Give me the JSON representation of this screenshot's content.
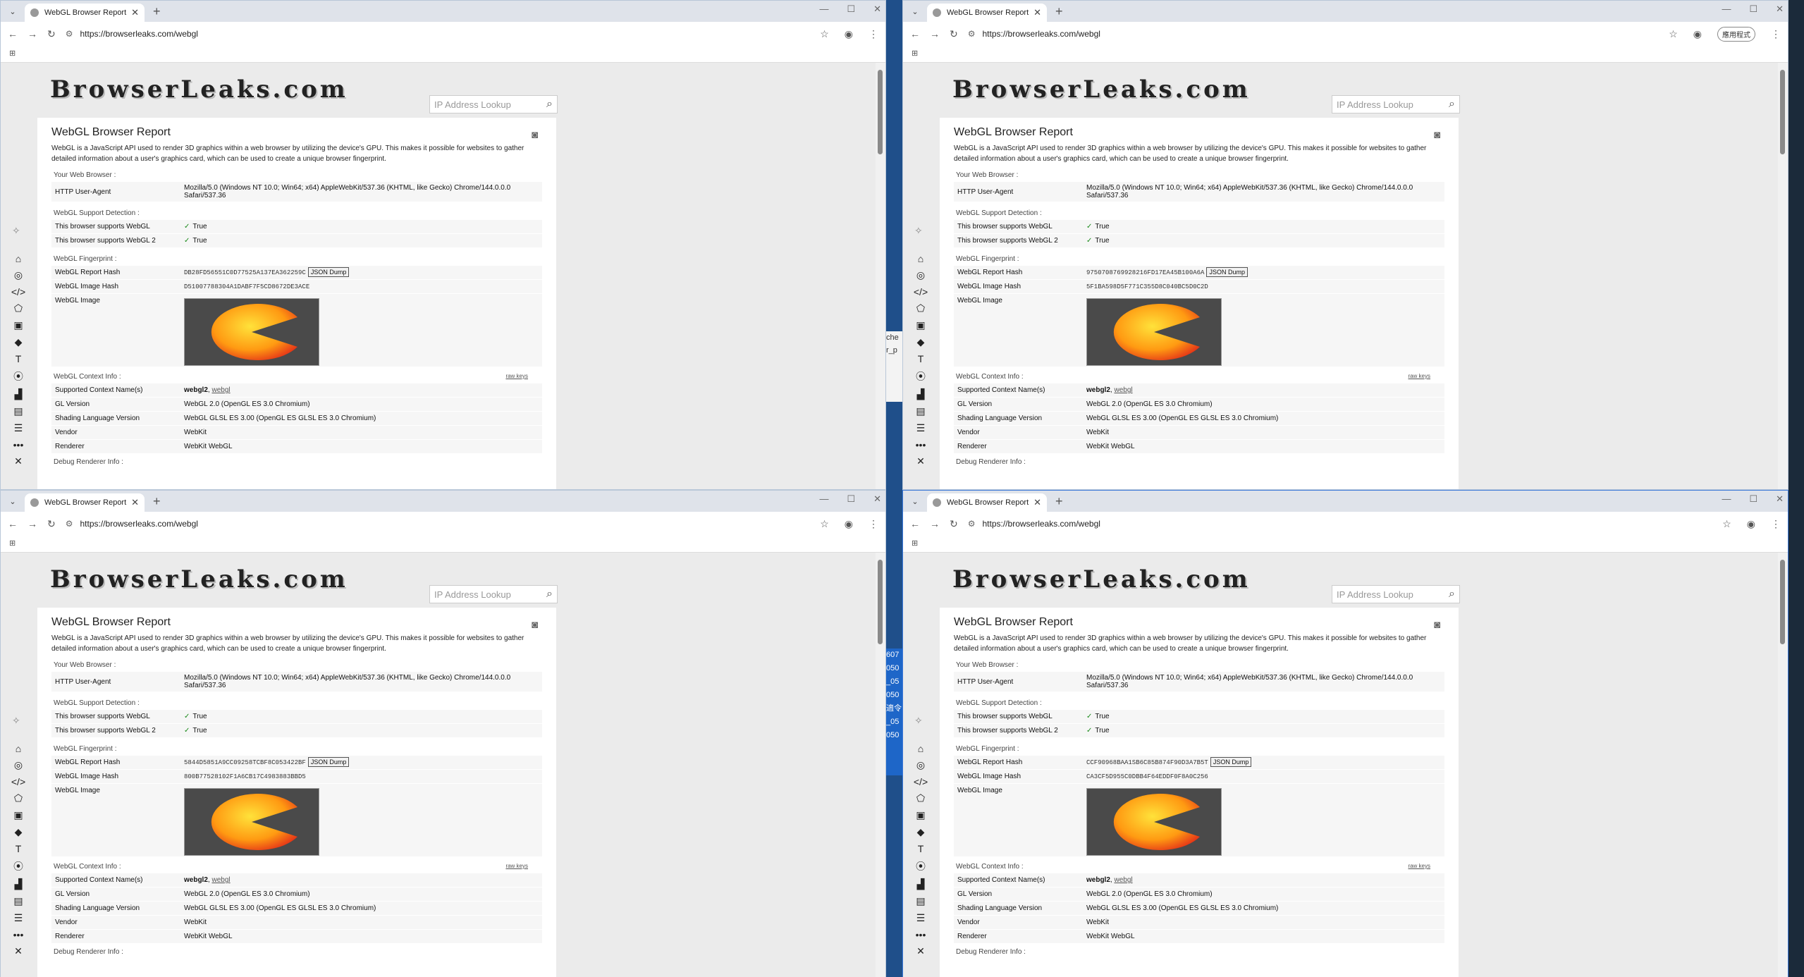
{
  "browser": {
    "tab_title": "WebGL Browser Report - We",
    "url": "https://browserleaks.com/webgl",
    "profile_label": "應用程式"
  },
  "page": {
    "logo": "BrowserLeaks.com",
    "ip_placeholder": "IP Address Lookup",
    "title": "WebGL Browser Report",
    "description": "WebGL is a JavaScript API used to render 3D graphics within a web browser by utilizing the device's GPU. This makes it possible for websites to gather detailed information about a user's graphics card, which can be used to create a unique browser fingerprint.",
    "sec_browser": "Your Web Browser :",
    "ua_label": "HTTP User-Agent",
    "ua_value": "Mozilla/5.0 (Windows NT 10.0; Win64; x64) AppleWebKit/537.36 (KHTML, like Gecko) Chrome/144.0.0.0 Safari/537.36",
    "sec_support": "WebGL Support Detection :",
    "support_webgl_label": "This browser supports WebGL",
    "support_webgl2_label": "This browser supports WebGL 2",
    "true_text": "True",
    "sec_fingerprint": "WebGL Fingerprint :",
    "report_hash_label": "WebGL Report Hash",
    "image_hash_label": "WebGL Image Hash",
    "json_dump": "JSON Dump",
    "image_label": "WebGL Image",
    "sec_context": "WebGL Context Info :",
    "raw_keys": "raw keys",
    "ctx_names_label": "Supported Context Name(s)",
    "ctx_names_primary": "webgl2",
    "ctx_names_secondary": "webgl",
    "gl_version_label": "GL Version",
    "gl_version_value": "WebGL 2.0 (OpenGL ES 3.0 Chromium)",
    "sl_version_label": "Shading Language Version",
    "sl_version_value": "WebGL GLSL ES 3.00 (OpenGL ES GLSL ES 3.0 Chromium)",
    "vendor_label": "Vendor",
    "vendor_value": "WebKit",
    "renderer_label": "Renderer",
    "renderer_value": "WebKit WebGL",
    "sec_debug": "Debug Renderer Info :"
  },
  "windows": [
    {
      "report_hash": "DB28FD56551C0D77525A137EA362259C",
      "image_hash": "D51007788304A1DABF7F5CD8672DE3ACE"
    },
    {
      "report_hash": "9750708769928216FD17EA45B100A6A",
      "image_hash": "5F1BA598D5F771C355D8C040BC5D0C2D"
    },
    {
      "report_hash": "5844D5851A9CC09258TCBF8C053422BF",
      "image_hash": "800B77528102F1A6CB17C4983883BBD5"
    },
    {
      "report_hash": "CCF90968BAA1SB6C85B874F90D3A7B5T",
      "image_hash": "CA3CF5D955C0DBB4F64EDDF0F8A0C256"
    }
  ],
  "desktop_fragments": [
    "che",
    "r_p",
    "607",
    "050",
    "_05",
    "050",
    "適令",
    "_05",
    "050"
  ],
  "colors": {
    "accent": "#1a8a1a",
    "window_border_active": "#3b78d8"
  }
}
